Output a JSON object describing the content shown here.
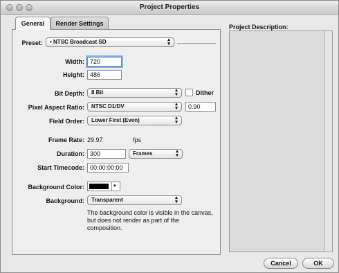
{
  "window": {
    "title": "Project Properties"
  },
  "tabs": [
    {
      "label": "General",
      "active": true
    },
    {
      "label": "Render Settings",
      "active": false
    }
  ],
  "general": {
    "preset": {
      "label": "Preset:",
      "value": "• NTSC Broadcast SD"
    },
    "width": {
      "label": "Width:",
      "value": "720"
    },
    "height": {
      "label": "Height:",
      "value": "486"
    },
    "bit_depth": {
      "label": "Bit Depth:",
      "value": "8 Bit"
    },
    "dither": {
      "label": "Dither",
      "checked": false
    },
    "pixel_aspect": {
      "label": "Pixel Aspect Ratio:",
      "value": "NTSC D1/DV",
      "ratio": "0.90"
    },
    "field_order": {
      "label": "Field Order:",
      "value": "Lower First (Even)"
    },
    "frame_rate": {
      "label": "Frame Rate:",
      "value": "29.97",
      "unit": "fps"
    },
    "duration": {
      "label": "Duration:",
      "value": "300",
      "unit": "Frames"
    },
    "start_timecode": {
      "label": "Start Timecode:",
      "value": "00:00:00;00"
    },
    "background_color": {
      "label": "Background Color:",
      "color": "#000000"
    },
    "background": {
      "label": "Background:",
      "value": "Transparent"
    },
    "note": "The background color is visible in the canvas, but does not render as part of the composition."
  },
  "description": {
    "label": "Project Description:",
    "value": ""
  },
  "buttons": {
    "cancel": "Cancel",
    "ok": "OK"
  },
  "icons": {
    "popup": "up-down-arrows-icon",
    "swatch_menu": "chevron-down-icon"
  }
}
